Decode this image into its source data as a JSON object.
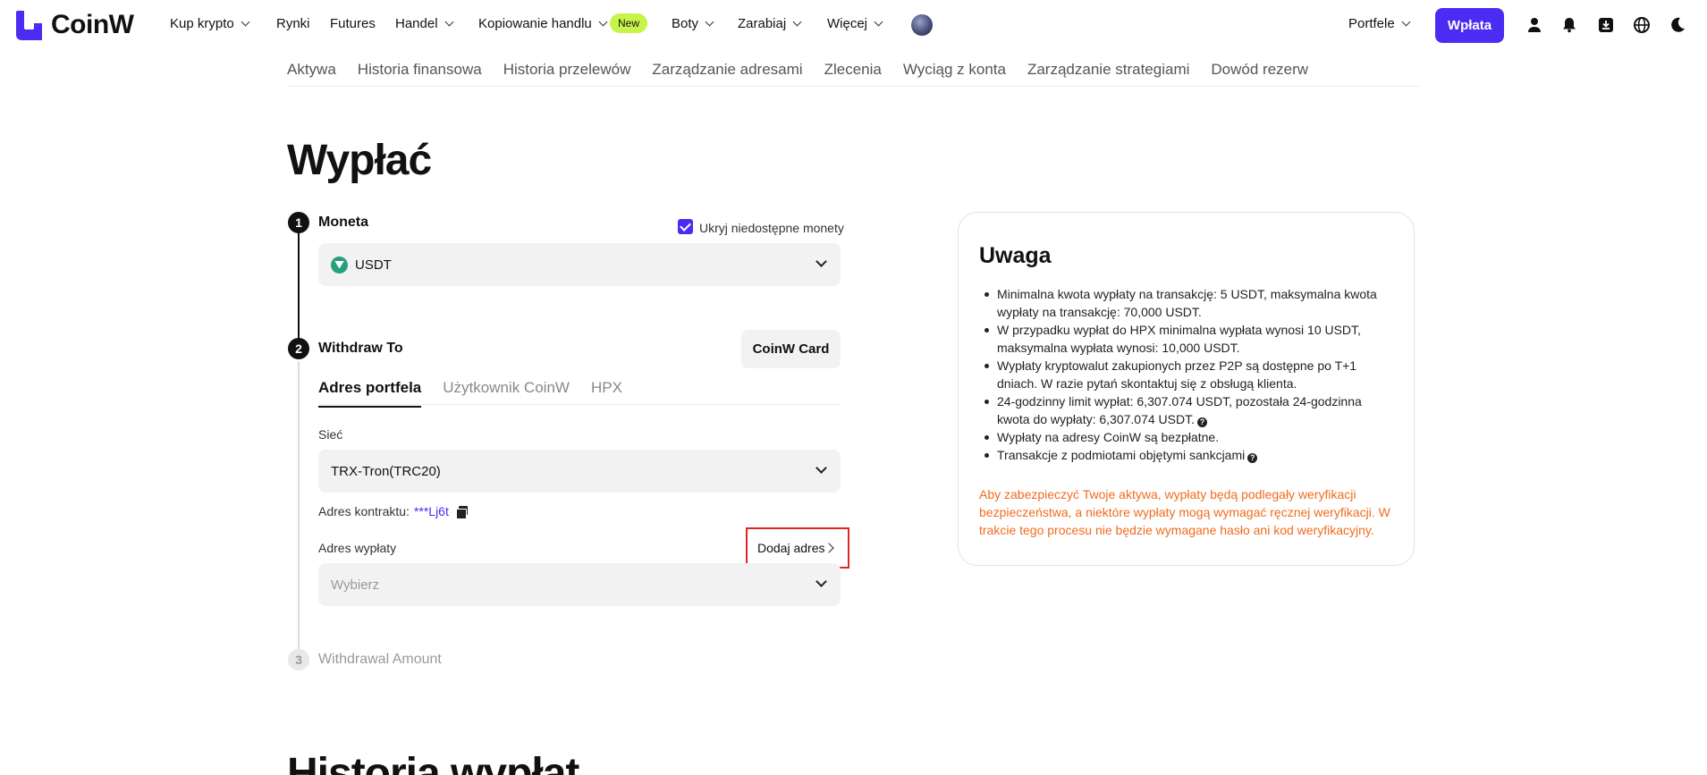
{
  "brand": {
    "name": "CoinW",
    "color": "#4b2cf3"
  },
  "nav": {
    "items": [
      {
        "label": "Kup krypto",
        "dropdown": true
      },
      {
        "label": "Rynki",
        "dropdown": false
      },
      {
        "label": "Futures",
        "dropdown": false
      },
      {
        "label": "Handel",
        "dropdown": true
      },
      {
        "label": "Kopiowanie handlu",
        "dropdown": true
      },
      {
        "label": "Boty",
        "dropdown": true
      },
      {
        "label": "Zarabiaj",
        "dropdown": true
      },
      {
        "label": "Więcej",
        "dropdown": true
      }
    ],
    "new_badge": "New",
    "wallets_label": "Portfele",
    "deposit_label": "Wpłata",
    "icons": [
      "user-icon",
      "bell-icon",
      "download-icon",
      "globe-icon",
      "moon-icon"
    ]
  },
  "subnav": {
    "items": [
      "Aktywa",
      "Historia finansowa",
      "Historia przelewów",
      "Zarządzanie adresami",
      "Zlecenia",
      "Wyciąg z konta",
      "Zarządzanie strategiami",
      "Dowód rezerw"
    ]
  },
  "page": {
    "title": "Wypłać",
    "history_title": "Historia wypłat"
  },
  "step1": {
    "number": "1",
    "label": "Moneta",
    "hide_unavailable_label": "Ukryj niedostępne monety",
    "hide_unavailable_checked": true,
    "coin": "USDT"
  },
  "step2": {
    "number": "2",
    "label": "Withdraw To",
    "card_button": "CoinW Card",
    "tabs": [
      "Adres portfela",
      "Użytkownik CoinW",
      "HPX"
    ],
    "active_tab": "Adres portfela",
    "network_label": "Sieć",
    "network_value": "TRX-Tron(TRC20)",
    "contract_label": "Adres kontraktu:",
    "contract_value": "***Lj6t",
    "address_label": "Adres wypłaty",
    "add_address_label": "Dodaj adres",
    "address_placeholder": "Wybierz"
  },
  "step3": {
    "number": "3",
    "label": "Withdrawal Amount"
  },
  "notice": {
    "title": "Uwaga",
    "items": [
      "Minimalna kwota wypłaty na transakcję: 5 USDT, maksymalna kwota wypłaty na transakcję: 70,000 USDT.",
      "W przypadku wypłat do HPX minimalna wypłata wynosi 10 USDT, maksymalna wypłata wynosi: 10,000 USDT.",
      "Wypłaty kryptowalut zakupionych przez P2P są dostępne po T+1 dniach. W razie pytań skontaktuj się z obsługą klienta.",
      "24-godzinny limit wypłat: 6,307.074 USDT, pozostała 24-godzinna kwota do wypłaty: 6,307.074 USDT.",
      "Wypłaty na adresy CoinW są bezpłatne.",
      "Transakcje z podmiotami objętymi sankcjami"
    ],
    "warning": "Aby zabezpieczyć Twoje aktywa, wypłaty będą podlegały weryfikacji bezpieczeństwa, a niektóre wypłaty mogą wymagać ręcznej weryfikacji. W trakcie tego procesu nie będzie wymagane hasło ani kod weryfikacyjny.",
    "warning_color": "#f26b1d",
    "qmark": "?"
  }
}
